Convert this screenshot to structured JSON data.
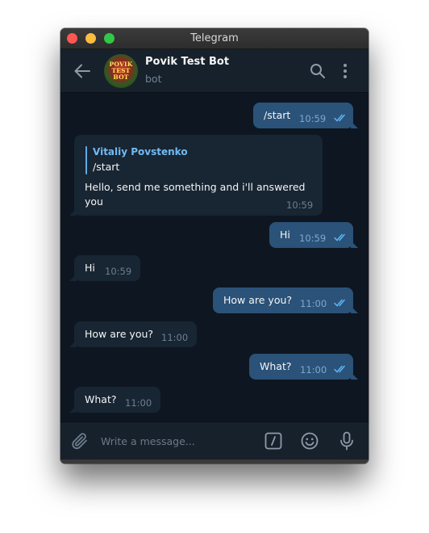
{
  "window": {
    "title": "Telegram"
  },
  "header": {
    "chat_title": "Povik Test Bot",
    "status": "bot",
    "avatar_text": "POVIK\nTEST\nBOT"
  },
  "messages": [
    {
      "direction": "out",
      "text": "/start",
      "time": "10:59",
      "read": true
    },
    {
      "direction": "in",
      "reply_to": {
        "author": "Vitaliy Povstenko",
        "text": "/start"
      },
      "text_lines": [
        "Hello, send me something and i'll answered",
        "you"
      ],
      "time": "10:59"
    },
    {
      "direction": "out",
      "text": "Hi",
      "time": "10:59",
      "read": true
    },
    {
      "direction": "in",
      "text": "Hi",
      "time": "10:59"
    },
    {
      "direction": "out",
      "text": "How are you?",
      "time": "11:00",
      "read": true
    },
    {
      "direction": "in",
      "text": "How are you?",
      "time": "11:00"
    },
    {
      "direction": "out",
      "text": "What?",
      "time": "11:00",
      "read": true
    },
    {
      "direction": "in",
      "text": "What?",
      "time": "11:00"
    }
  ],
  "composer": {
    "placeholder": "Write a message..."
  },
  "icons": {
    "back": "back-arrow-icon",
    "search": "search-icon",
    "more": "more-vertical-icon",
    "attach": "paperclip-icon",
    "commands": "bot-commands-icon",
    "emoji": "emoji-icon",
    "mic": "microphone-icon",
    "read": "double-check-icon"
  },
  "colors": {
    "background": "#0e1621",
    "header": "#17212b",
    "outgoing_bubble": "#2b5278",
    "incoming_bubble": "#182533",
    "accent": "#5eabe6",
    "read_check": "#5eb5f7"
  }
}
